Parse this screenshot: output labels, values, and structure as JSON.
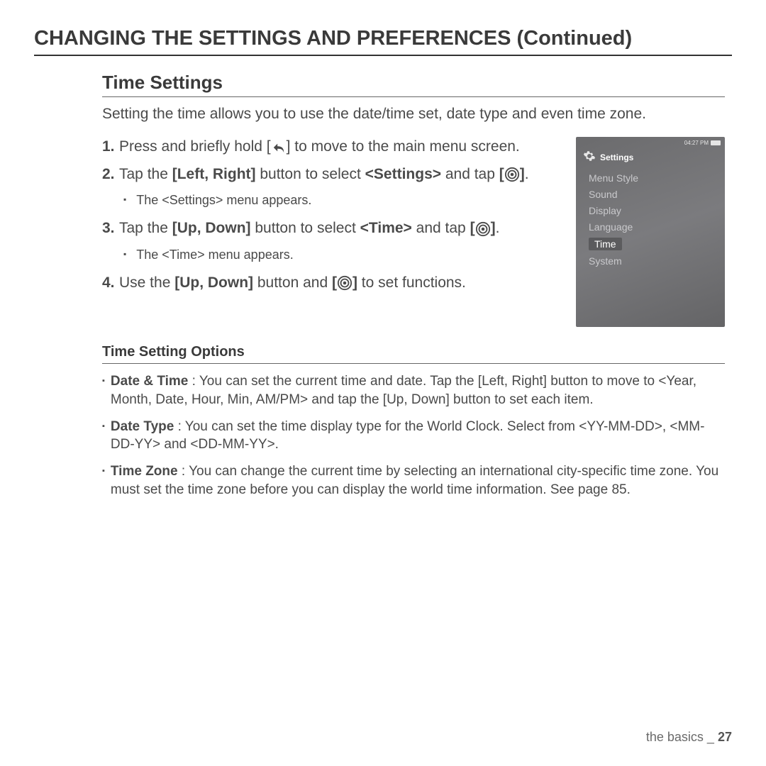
{
  "page_title": "CHANGING THE SETTINGS AND PREFERENCES (Continued)",
  "section_heading": "Time Settings",
  "intro": "Setting the time allows you to use the date/time set, date type and even time zone.",
  "steps": {
    "s1_num": "1.",
    "s1_a": "Press and briefly hold [",
    "s1_b": "] to move to the main menu screen.",
    "s2_num": "2.",
    "s2_a": "Tap the ",
    "s2_bold": "[Left, Right]",
    "s2_b": " button to select ",
    "s2_bold2": "<Settings>",
    "s2_c": " and tap ",
    "s2_bold3": "[",
    "s2_bold4": "]",
    "s2_d": ".",
    "s2_sub": "The <Settings> menu appears.",
    "s3_num": "3.",
    "s3_a": "Tap the ",
    "s3_bold": "[Up, Down]",
    "s3_b": " button to select ",
    "s3_bold2": "<Time>",
    "s3_c": " and tap ",
    "s3_bold3": "[",
    "s3_bold4": "]",
    "s3_d": ".",
    "s3_sub": "The <Time> menu appears.",
    "s4_num": "4.",
    "s4_a": "Use the ",
    "s4_bold": "[Up, Down]",
    "s4_b": " button and ",
    "s4_bold2": "[",
    "s4_bold3": "]",
    "s4_c": " to set functions."
  },
  "device": {
    "time": "04:27 PM",
    "title": "Settings",
    "items": [
      "Menu Style",
      "Sound",
      "Display",
      "Language",
      "Time",
      "System"
    ],
    "selected_index": 4
  },
  "sub_heading": "Time Setting Options",
  "options": {
    "o1_bold": "Date & Time",
    "o1_text": " : You can set the current time and date. Tap the [Left, Right] button to move to <Year, Month, Date, Hour, Min, AM/PM> and tap the [Up, Down] button to set each item.",
    "o2_bold": "Date Type",
    "o2_text": " : You can set the time display type for the World Clock. Select from <YY-MM-DD>, <MM-DD-YY> and <DD-MM-YY>.",
    "o3_bold": "Time Zone",
    "o3_text": " : You can change the current time by selecting an international city-specific time zone. You must set the time zone before you can display the world time information. See page 85."
  },
  "footer": {
    "section": "the basics _",
    "page": "27"
  }
}
